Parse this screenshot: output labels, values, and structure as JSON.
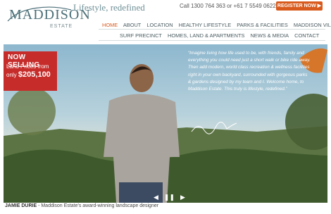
{
  "header": {
    "logo_text": "MADDISON",
    "logo_sub": "ESTATE",
    "tagline": "Lifestyle, redefined",
    "phone": "Call 1300 764 363 or +61 7 5549 0622",
    "register_label": "REGISTER NOW ▶"
  },
  "nav": {
    "row1": [
      "HOME",
      "ABOUT",
      "LOCATION",
      "HEALTHY LIFESTYLE",
      "PARKS & FACILITIES",
      "MADDISON VILLAGE"
    ],
    "row2": [
      "SURF PRECINCT",
      "HOMES, LAND & APARTMENTS",
      "NEWS & MEDIA",
      "CONTACT"
    ],
    "active": "HOME"
  },
  "promo": {
    "title": "NOW SELLING",
    "line1": "Land Prices from",
    "line2": "only",
    "price": "$205,100"
  },
  "quote": "“Imagine living how life used to be, with friends, family and everything you could need just a short walk or bike ride away. Then add modern, world class recreation & wellness facilities right in your own backyard, surrounded with gorgeous parks & gardens designed by my team and I. Welcome home, to Maddison Estate. This truly is lifestyle, redefined.”",
  "slider": {
    "prev": "◀",
    "pause": "❚❚",
    "next": "▶"
  },
  "caption": {
    "name": "JAMIE DURIE",
    "text": " - Maddison Estate's award-winning landscape designer"
  },
  "colors": {
    "accent": "#d85a1c",
    "promo_red": "#c62c2a",
    "brand_teal": "#4b6f78"
  }
}
